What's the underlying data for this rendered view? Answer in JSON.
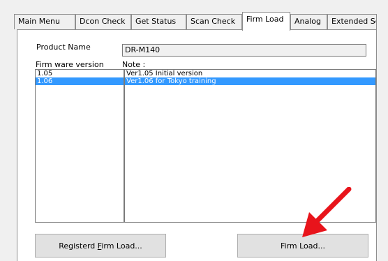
{
  "tabs": [
    {
      "label": "Main Menu"
    },
    {
      "label": "Dcon Check"
    },
    {
      "label": "Get Status"
    },
    {
      "label": "Scan Check"
    },
    {
      "label": "Firm Load",
      "active": true
    },
    {
      "label": "Analog"
    },
    {
      "label": "Extended Setting"
    }
  ],
  "product": {
    "label": "Product Name",
    "value": "DR-M140"
  },
  "firmware": {
    "version_label": "Firm ware version",
    "note_label": "Note :",
    "rows": [
      {
        "version": "1.05",
        "note": "Ver1.05 Initial version",
        "selected": false
      },
      {
        "version": "1.06",
        "note": "Ver1.06 for Tokyo training",
        "selected": true
      }
    ]
  },
  "buttons": {
    "registered_prefix": "Registerd ",
    "registered_mnemonic": "F",
    "registered_suffix": "irm Load...",
    "firm_load": "Firm Load..."
  },
  "colors": {
    "selection": "#3399ff",
    "annotation_arrow": "#e8141b"
  },
  "annotation": {
    "icon": "red-arrow-icon"
  }
}
